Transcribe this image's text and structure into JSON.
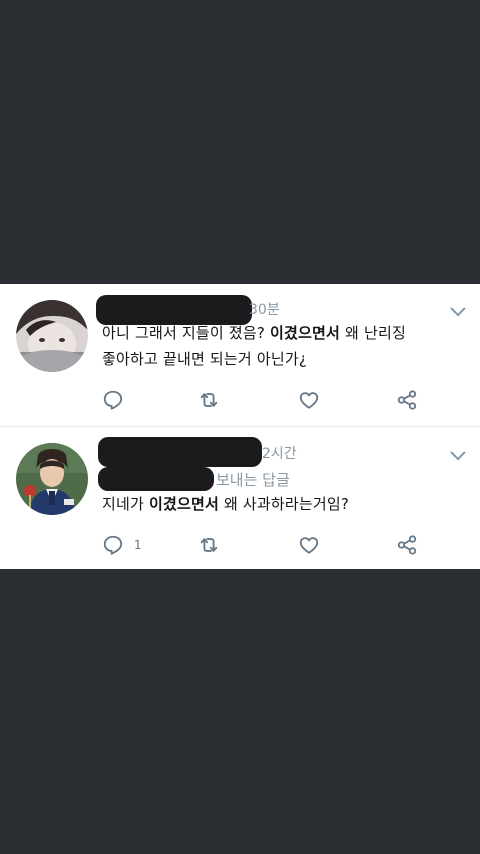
{
  "tweets": [
    {
      "time": "30분",
      "line1_a": "아니 그래서 지들이 졌음? ",
      "line1_b": "이겼으면서",
      "line1_c": " 왜 난리징",
      "line2": "좋아하고 끝내면 되는거 아닌가¿"
    },
    {
      "time": "2시간",
      "reply_context": "보내는 답글",
      "text_a": "지네가 ",
      "text_b": "이겼으면서",
      "text_c": " 왜 사과하라는거임?",
      "reply_count": "1"
    }
  ],
  "colors": {
    "background": "#2a2d31",
    "card": "#ffffff",
    "icon": "#657786"
  },
  "icons": [
    "chevron-down-icon",
    "reply-icon",
    "retweet-icon",
    "like-icon",
    "share-icon"
  ]
}
